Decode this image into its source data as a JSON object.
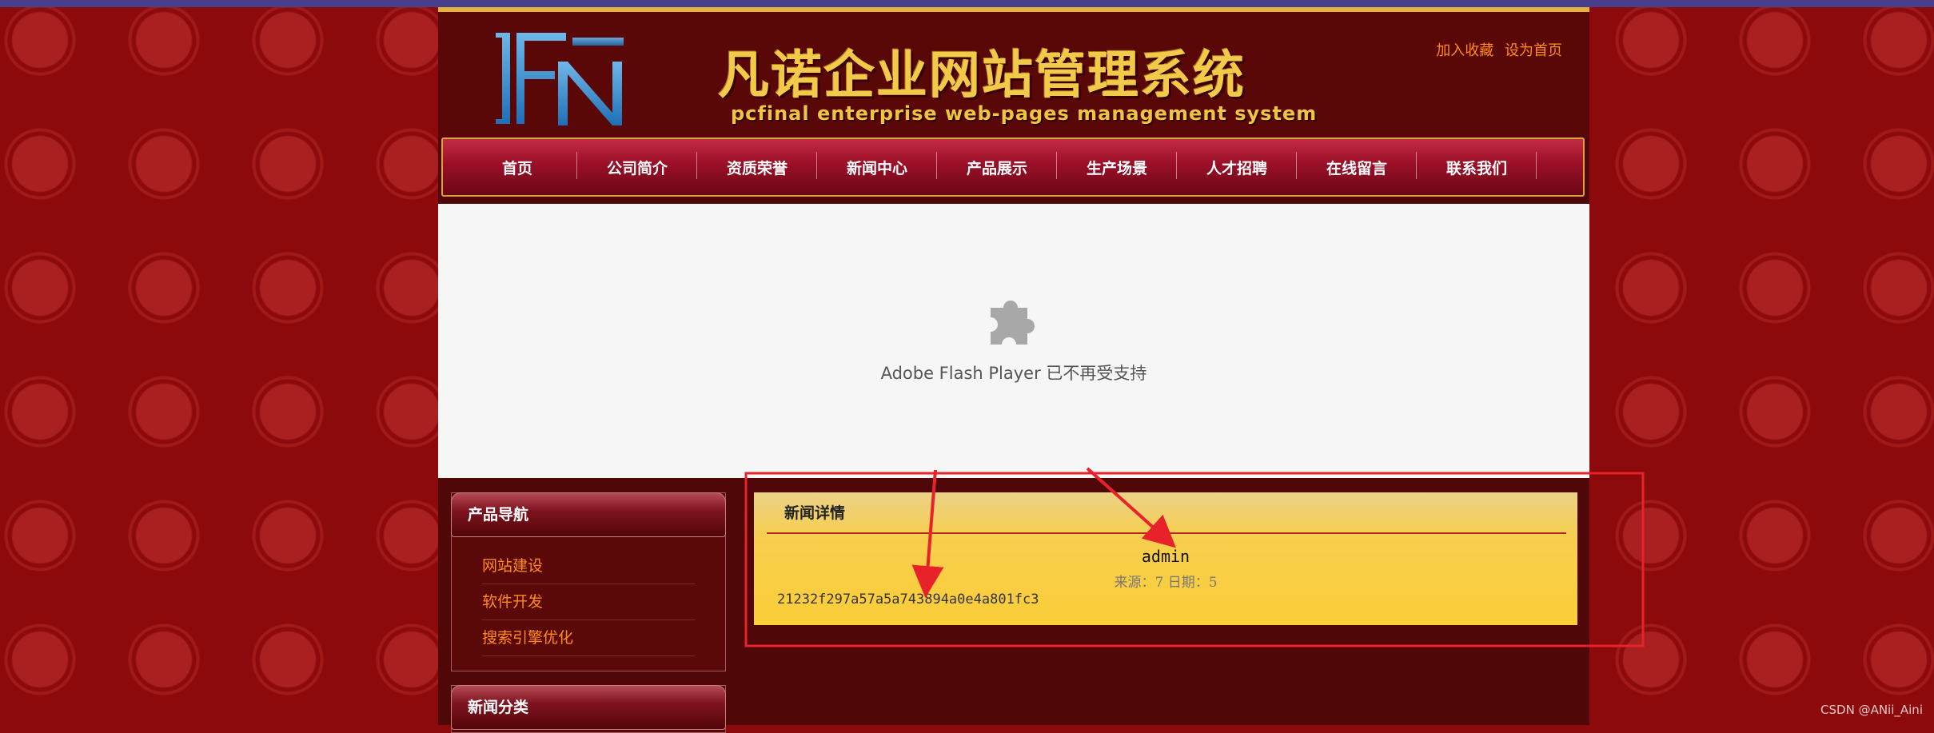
{
  "header": {
    "title_cn": "凡诺企业网站管理系统",
    "title_en": "pcfinal enterprise web-pages management system",
    "links": [
      "加入收藏",
      "设为首页"
    ],
    "logo_text": "FN"
  },
  "nav": {
    "items": [
      "首页",
      "公司简介",
      "资质荣誉",
      "新闻中心",
      "产品展示",
      "生产场景",
      "人才招聘",
      "在线留言",
      "联系我们"
    ]
  },
  "flash": {
    "icon": "puzzle-piece-icon",
    "message": "Adobe Flash Player 已不再受支持"
  },
  "sidebar": {
    "product_nav": {
      "title": "产品导航",
      "items": [
        "网站建设",
        "软件开发",
        "搜索引擎优化"
      ]
    },
    "news_cat": {
      "title": "新闻分类"
    }
  },
  "news": {
    "header": "新闻详情",
    "title": "admin",
    "meta": "来源：7 日期：5",
    "body": "21232f297a57a5a743894a0e4a801fc3"
  },
  "watermark": "CSDN @ANii_Aini",
  "colors": {
    "page_bg": "#8c0a0c",
    "content_bg": "#4f0708",
    "nav_red": "#9a0f27",
    "link_orange": "#ff8c1a",
    "gold": "#f3c94a",
    "annotation_red": "#e8222a"
  }
}
